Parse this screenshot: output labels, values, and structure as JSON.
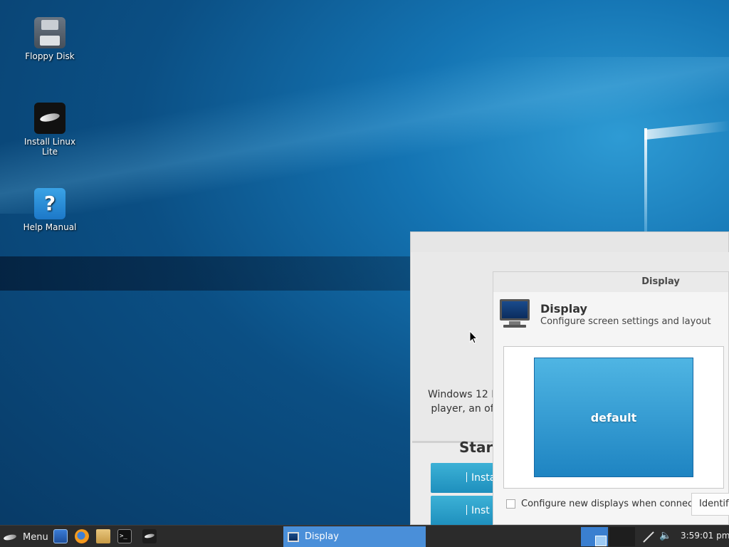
{
  "desktop": {
    "icons": [
      {
        "label": "Floppy Disk",
        "icon": "floppy-disk-icon"
      },
      {
        "label": "Install Linux Lite",
        "icon": "linux-lite-feather-icon"
      },
      {
        "label": "Help Manual",
        "icon": "help-question-icon"
      }
    ]
  },
  "back_window": {
    "text_line1": "Windows 12 L",
    "text_line2": "player, an of",
    "start_heading": "Start",
    "install_button_1": "Insta",
    "install_button_2": "Inst"
  },
  "display_window": {
    "title": "Display",
    "header_title": "Display",
    "header_subtitle": "Configure screen settings and layout",
    "display_name": "default",
    "checkbox_label": "Configure new displays when connected",
    "checkbox_checked": false,
    "identify_button": "Identify"
  },
  "taskbar": {
    "menu_label": "Menu",
    "launchers": [
      "file-manager-icon",
      "firefox-icon",
      "home-folder-icon",
      "terminal-icon",
      "linux-lite-icon"
    ],
    "active_task": "Display",
    "clock": "3:59:01 pm",
    "tray_icons": [
      "network-icon",
      "volume-icon"
    ]
  },
  "colors": {
    "taskbar_bg": "#2b2b2b",
    "task_active": "#4a8fd9",
    "display_tile": "#2f9bd6"
  }
}
